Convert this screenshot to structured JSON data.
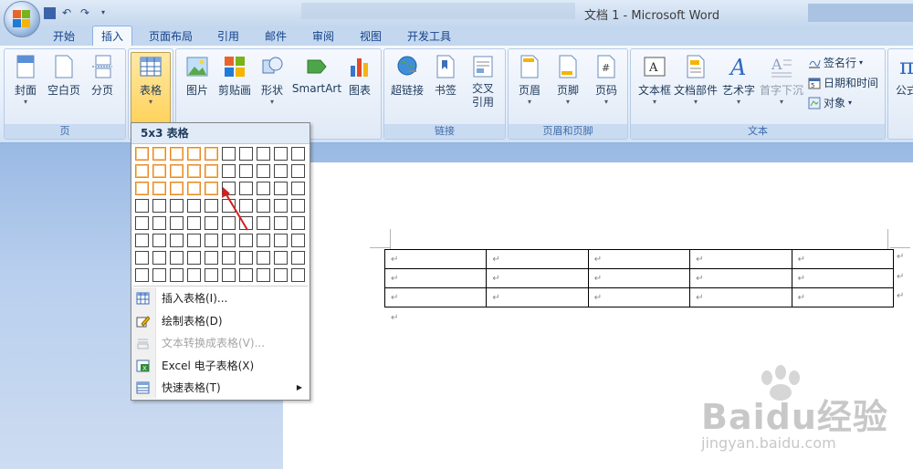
{
  "window": {
    "title": "文档 1 - Microsoft Word"
  },
  "tabs": [
    {
      "label": "开始"
    },
    {
      "label": "插入"
    },
    {
      "label": "页面布局"
    },
    {
      "label": "引用"
    },
    {
      "label": "邮件"
    },
    {
      "label": "审阅"
    },
    {
      "label": "视图"
    },
    {
      "label": "开发工具"
    }
  ],
  "ribbon": {
    "groups": {
      "page": {
        "label": "页",
        "buttons": [
          "封面",
          "空白页",
          "分页"
        ]
      },
      "tables": {
        "buttons": [
          "表格"
        ]
      },
      "illustrations": {
        "buttons": [
          "图片",
          "剪贴画",
          "形状",
          "SmartArt",
          "图表"
        ]
      },
      "links": {
        "label": "链接",
        "buttons": [
          "超链接",
          "书签",
          "交叉引用"
        ]
      },
      "header_footer": {
        "label": "页眉和页脚",
        "buttons": [
          "页眉",
          "页脚",
          "页码"
        ]
      },
      "text": {
        "label": "文本",
        "buttons": [
          "文本框",
          "文档部件",
          "艺术字",
          "首字下沉"
        ],
        "small": [
          "签名行",
          "日期和时间",
          "对象"
        ]
      },
      "symbols": {
        "buttons": [
          "公式"
        ]
      }
    }
  },
  "table_menu": {
    "header": "5x3 表格",
    "grid": {
      "cols": 10,
      "rows": 8,
      "selected_cols": 5,
      "selected_rows": 3
    },
    "items": [
      {
        "label": "插入表格(I)...",
        "enabled": true
      },
      {
        "label": "绘制表格(D)",
        "enabled": true
      },
      {
        "label": "文本转换成表格(V)...",
        "enabled": false
      },
      {
        "label": "Excel 电子表格(X)",
        "enabled": true
      },
      {
        "label": "快速表格(T)",
        "enabled": true,
        "submenu": true
      }
    ]
  },
  "document": {
    "table": {
      "rows": 3,
      "cols": 5,
      "cell_mark": "↵"
    },
    "paragraph_mark": "↵"
  },
  "watermark": {
    "logo": "Baidu经验",
    "url": "jingyan.baidu.com"
  },
  "colors": {
    "accent": "#e58a2e",
    "ribbon_bg": "#dfe9f6",
    "arrow": "#d21e1e"
  }
}
